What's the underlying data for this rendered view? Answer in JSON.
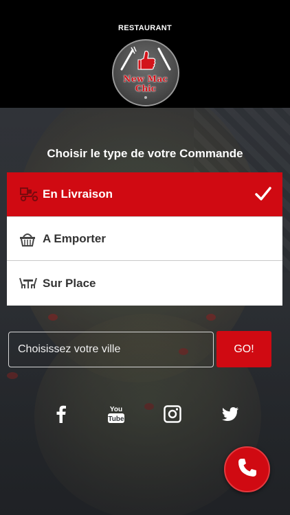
{
  "header": {
    "restaurant_label": "RESTAURANT",
    "logo": {
      "name_line1": "New Mac",
      "name_line2": "Chic",
      "icon": "thumbs-up-fork-knife-logo"
    }
  },
  "order_type": {
    "title": "Choisir le type de votre Commande",
    "options": [
      {
        "label": "En Livraison",
        "icon": "delivery-scooter-icon",
        "selected": true
      },
      {
        "label": "A Emporter",
        "icon": "basket-icon",
        "selected": false
      },
      {
        "label": "Sur Place",
        "icon": "dining-table-icon",
        "selected": false
      }
    ]
  },
  "city_search": {
    "placeholder": "Choisissez votre ville",
    "go_label": "GO!"
  },
  "social": [
    "facebook-icon",
    "youtube-icon",
    "instagram-icon",
    "twitter-icon"
  ],
  "colors": {
    "accent": "#d00a12",
    "header_bg": "#000000",
    "text_on_accent": "#ffffff"
  }
}
